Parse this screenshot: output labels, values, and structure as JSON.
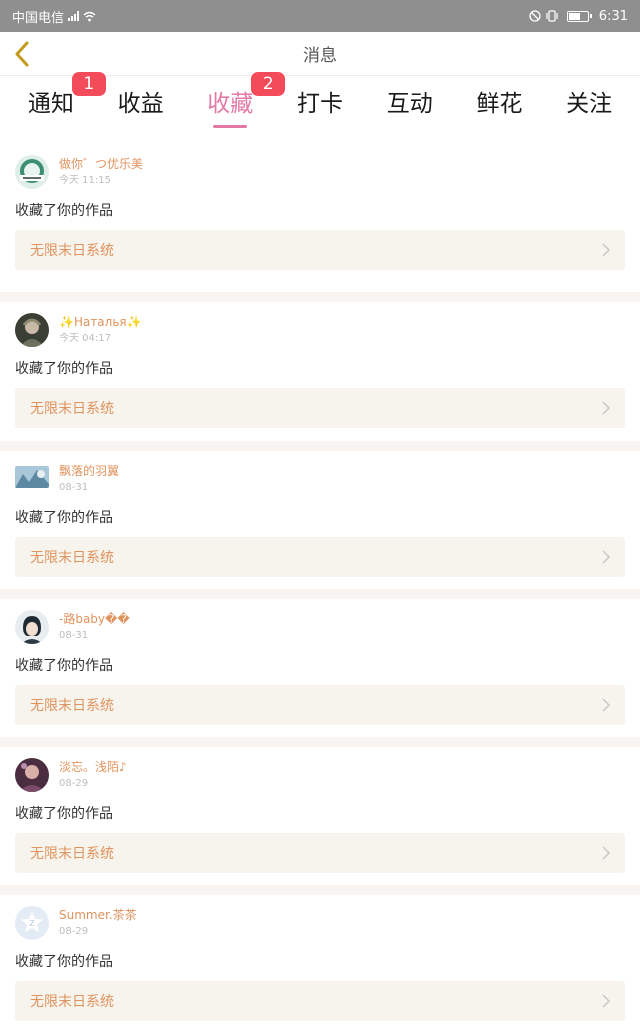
{
  "status_bar": {
    "carrier": "中国电信",
    "network": "4G",
    "time": "6:31",
    "battery_level": 0.65
  },
  "header": {
    "title": "消息",
    "back_icon": "chevron-left-icon"
  },
  "tabs": [
    {
      "label": "通知",
      "badge": "1"
    },
    {
      "label": "收益",
      "badge": ""
    },
    {
      "label": "收藏",
      "badge": "2",
      "active": true
    },
    {
      "label": "打卡",
      "badge": ""
    },
    {
      "label": "互动",
      "badge": ""
    },
    {
      "label": "鲜花",
      "badge": ""
    },
    {
      "label": "关注",
      "badge": ""
    }
  ],
  "messages": [
    {
      "username": "做你゛つ优乐美",
      "time": "今天 11:15",
      "action": "收藏了你的作品",
      "work_title": "无限末日系统"
    },
    {
      "username": "✨Наталья✨",
      "time": "今天 04:17",
      "action": "收藏了你的作品",
      "work_title": "无限末日系统"
    },
    {
      "username": "飘落的羽翼",
      "time": "08-31",
      "action": "收藏了你的作品",
      "work_title": "无限末日系统"
    },
    {
      "username": "-路baby��",
      "time": "08-31",
      "action": "收藏了你的作品",
      "work_title": "无限末日系统"
    },
    {
      "username": "淡忘。浅陌♪",
      "time": "08-29",
      "action": "收藏了你的作品",
      "work_title": "无限末日系统"
    },
    {
      "username": "Summer.茶茶",
      "time": "08-29",
      "action": "收藏了你的作品",
      "work_title": "无限末日系统"
    }
  ],
  "colors": {
    "accent": "#e279a6",
    "badge": "#f34b5a",
    "username": "#e0935e",
    "card_bg": "#f6f4ec",
    "status_bar": "#8f8f8f",
    "back_icon": "#c49a1a"
  }
}
